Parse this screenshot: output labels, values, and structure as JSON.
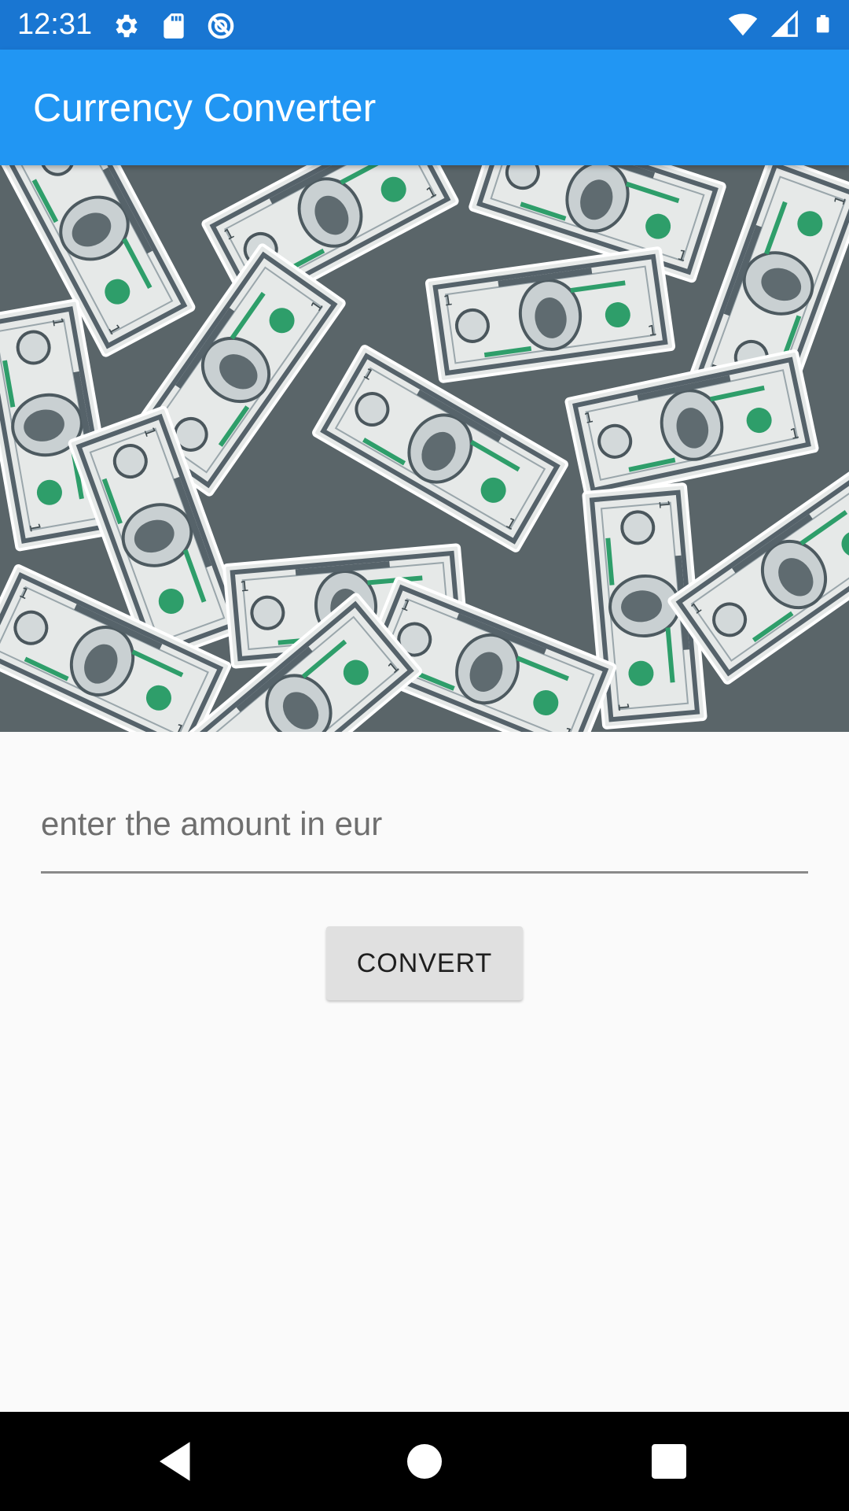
{
  "status_bar": {
    "time": "12:31",
    "left_icons": [
      "settings-icon",
      "sd-card-icon",
      "sync-disabled-icon"
    ],
    "right_icons": [
      "wifi-icon",
      "cell-signal-icon",
      "battery-icon"
    ]
  },
  "app_bar": {
    "title": "Currency Converter",
    "color": "#2196f3"
  },
  "banner": {
    "description_icon": "dollar-bills-image"
  },
  "form": {
    "amount_placeholder": "enter the amount in eur",
    "amount_value": "",
    "convert_label": "CONVERT"
  },
  "nav_bar": {
    "buttons": [
      "back-icon",
      "home-icon",
      "recents-icon"
    ]
  },
  "colors": {
    "status_bar": "#1976d2",
    "app_bar": "#2196f3",
    "background": "#fafafa",
    "button": "#e0e0e0",
    "bill_green": "#2e9e6a"
  }
}
